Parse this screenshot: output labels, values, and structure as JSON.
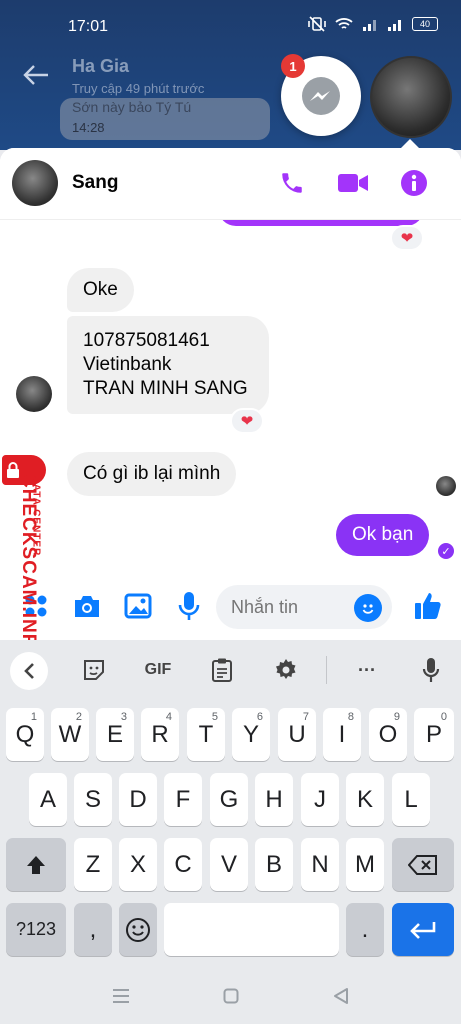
{
  "status_bar": {
    "time": "17:01",
    "battery": "40"
  },
  "background_chat": {
    "name": "Ha Gia",
    "subtitle": "Truy cập 49 phút trước",
    "bubble_text": "Sớn này bảo Tý Tú",
    "bubble_time": "14:28"
  },
  "chathead": {
    "badge": "1"
  },
  "conversation": {
    "contact_name": "Sang",
    "messages": [
      {
        "from": "contact",
        "text": "Oke"
      },
      {
        "from": "contact",
        "lines": [
          "107875081461",
          "Vietinbank",
          "TRAN MINH SANG"
        ],
        "reaction": "❤"
      },
      {
        "from": "contact",
        "text": "Có gì ib lại mình"
      },
      {
        "from": "me",
        "text": "Ok bạn"
      }
    ],
    "previous_reaction": "❤"
  },
  "composer": {
    "placeholder": "Nhắn tin"
  },
  "keyboard": {
    "toolbar": {
      "gif": "GIF",
      "more": "···"
    },
    "row1": [
      {
        "k": "Q",
        "h": "1"
      },
      {
        "k": "W",
        "h": "2"
      },
      {
        "k": "E",
        "h": "3"
      },
      {
        "k": "R",
        "h": "4"
      },
      {
        "k": "T",
        "h": "5"
      },
      {
        "k": "Y",
        "h": "6"
      },
      {
        "k": "U",
        "h": "7"
      },
      {
        "k": "I",
        "h": "8"
      },
      {
        "k": "O",
        "h": "9"
      },
      {
        "k": "P",
        "h": "0"
      }
    ],
    "row2": [
      "A",
      "S",
      "D",
      "F",
      "G",
      "H",
      "J",
      "K",
      "L"
    ],
    "row3": [
      "Z",
      "X",
      "C",
      "V",
      "B",
      "N",
      "M"
    ],
    "symbols_key": "?123",
    "comma_key": ",",
    "period_key": "."
  },
  "watermark": {
    "brand": "CHECKSCAM.INFO",
    "sub": "DATA CENTER"
  },
  "colors": {
    "accent": "#8a33f5",
    "messenger_blue": "#0a7cff",
    "enter_blue": "#1a73e8"
  }
}
